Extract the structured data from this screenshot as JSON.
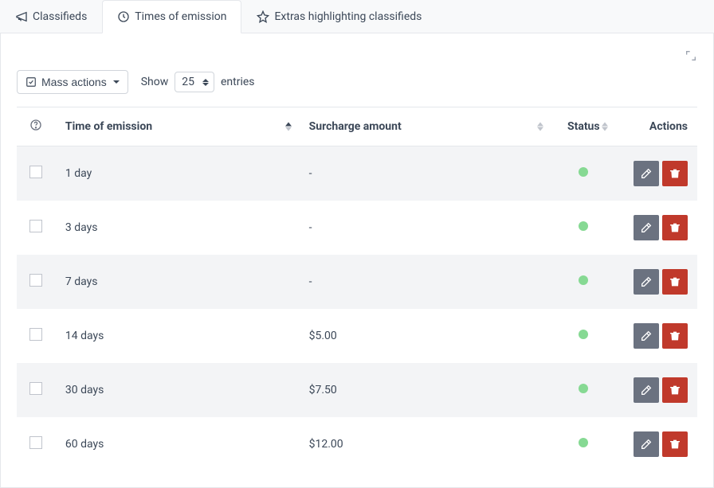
{
  "tabs": [
    {
      "label": "Classifieds"
    },
    {
      "label": "Times of emission"
    },
    {
      "label": "Extras highlighting classifieds"
    }
  ],
  "controls": {
    "mass_actions": "Mass actions",
    "show": "Show",
    "entries": "entries",
    "page_size": "25"
  },
  "columns": {
    "time": "Time of emission",
    "surcharge": "Surcharge amount",
    "status": "Status",
    "actions": "Actions"
  },
  "rows": [
    {
      "time": "1 day",
      "surcharge": "-"
    },
    {
      "time": "3 days",
      "surcharge": "-"
    },
    {
      "time": "7 days",
      "surcharge": "-"
    },
    {
      "time": "14 days",
      "surcharge": "$5.00"
    },
    {
      "time": "30 days",
      "surcharge": "$7.50"
    },
    {
      "time": "60 days",
      "surcharge": "$12.00"
    }
  ],
  "colors": {
    "status_active": "#86d993",
    "edit_bg": "#6b7280",
    "delete_bg": "#c0392b"
  }
}
